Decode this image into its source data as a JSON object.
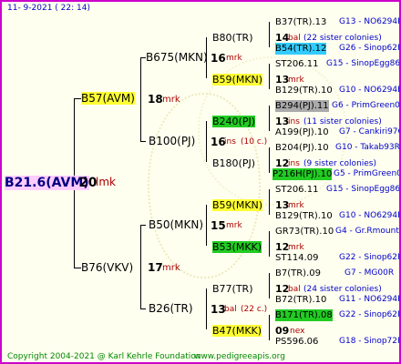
{
  "header": {
    "date": "11- 9-2021 ( 22: 14)"
  },
  "root": {
    "label": "B21.6(AVM)",
    "num": "20",
    "code": "lmk"
  },
  "gen1": [
    {
      "label": "B57(AVM)",
      "num": "18",
      "code": "mrk"
    },
    {
      "label": "B76(VKV)",
      "num": "17",
      "code": "mrk"
    }
  ],
  "gen2": [
    {
      "label": "B675(MKN)",
      "num": "16",
      "code": "mrk"
    },
    {
      "label": "B100(PJ)",
      "num": "16",
      "code": "ins",
      "note": "(10 c.)"
    },
    {
      "label": "B50(MKN)",
      "num": "15",
      "code": "mrk"
    },
    {
      "label": "B26(TR)",
      "num": "13",
      "code": "bal",
      "note": "(22 c.)"
    }
  ],
  "gen3": [
    {
      "label": "B80(TR)",
      "num": "14",
      "code": "bal",
      "note": "(22 sister colonies)"
    },
    {
      "label": "B59(MKN)",
      "num": "13",
      "code": "mrk"
    },
    {
      "label": "B240(PJ)",
      "num": "13",
      "code": "ins",
      "note": "(11 sister colonies)"
    },
    {
      "label": "B180(PJ)",
      "num": "12",
      "code": "ins",
      "note": "(9 sister colonies)"
    },
    {
      "label": "B59(MKN)",
      "num": "13",
      "code": "mrk"
    },
    {
      "label": "B53(MKK)",
      "num": "12",
      "code": "mrk"
    },
    {
      "label": "B77(TR)",
      "num": "12",
      "code": "bal",
      "note": "(24 sister colonies)"
    },
    {
      "label": "B47(MKK)",
      "num": "09",
      "code": "nex"
    }
  ],
  "gen4": [
    {
      "name": "B37(TR).13",
      "code": "G13 - NO6294R"
    },
    {
      "name": "B54(TR).12",
      "code": "G26 - Sinop62R"
    },
    {
      "name": "ST206.11",
      "code": "G15 - SinopEgg86R"
    },
    {
      "name": "B129(TR).10",
      "code": "G10 - NO6294R"
    },
    {
      "name": "B294(PJ).11",
      "code": "G6 - PrimGreen00"
    },
    {
      "name": "A199(PJ).10",
      "code": "G7 - Cankiri97Q"
    },
    {
      "name": "B204(PJ).10",
      "code": "G10 - Takab93R"
    },
    {
      "name": "P216H(PJ).10",
      "code": "G5 - PrimGreen00"
    },
    {
      "name": "ST206.11",
      "code": "G15 - SinopEgg86R"
    },
    {
      "name": "B129(TR).10",
      "code": "G10 - NO6294R"
    },
    {
      "name": "GR73(TR).10",
      "code": "G4 - Gr.Rmounta"
    },
    {
      "name": "ST114.09",
      "code": "G22 - Sinop62R"
    },
    {
      "name": "B7(TR).09",
      "code": "G7 - MG00R"
    },
    {
      "name": "B72(TR).10",
      "code": "G11 - NO6294R"
    },
    {
      "name": "B171(TR).08",
      "code": "G22 - Sinop62R"
    },
    {
      "name": "PS596.06",
      "code": "G18 - Sinop72R"
    }
  ],
  "footer": {
    "copyright": "Copyright 2004-2021 @ Karl Kehrle Foundation",
    "site": "www.pedigreeapis.org"
  }
}
